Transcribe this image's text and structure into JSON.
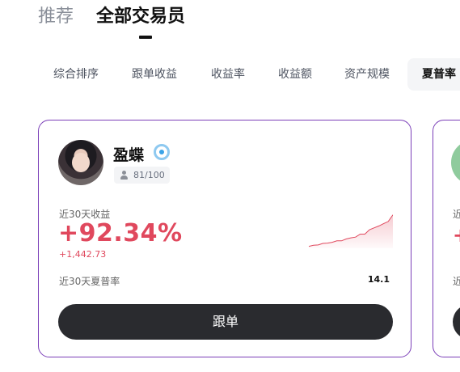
{
  "top_tabs": {
    "recommended": "推荐",
    "all_traders": "全部交易员"
  },
  "filters": [
    "综合排序",
    "跟单收益",
    "收益率",
    "收益额",
    "资产规模",
    "夏普率"
  ],
  "selected_filter": "夏普率",
  "trader_card": {
    "name": "盈蝶",
    "followers": "81/100",
    "return_label": "近30天收益",
    "return_pct": "+92.34%",
    "return_abs": "+1,442.73",
    "sharpe_label": "近30天夏普率",
    "sharpe_value": "14.1",
    "follow_button": "跟单",
    "sparkline": [
      0.05,
      0.08,
      0.09,
      0.13,
      0.14,
      0.16,
      0.2,
      0.2,
      0.25,
      0.28,
      0.3,
      0.38,
      0.38,
      0.5,
      0.55,
      0.6,
      0.66,
      0.72,
      0.9
    ]
  },
  "peek_card": {
    "label_prefix": "近",
    "value_prefix": "+",
    "label_prefix_2": "近"
  },
  "colors": {
    "positive": "#e0485d",
    "border": "#7b3fb8",
    "button": "#2a2b2f"
  }
}
